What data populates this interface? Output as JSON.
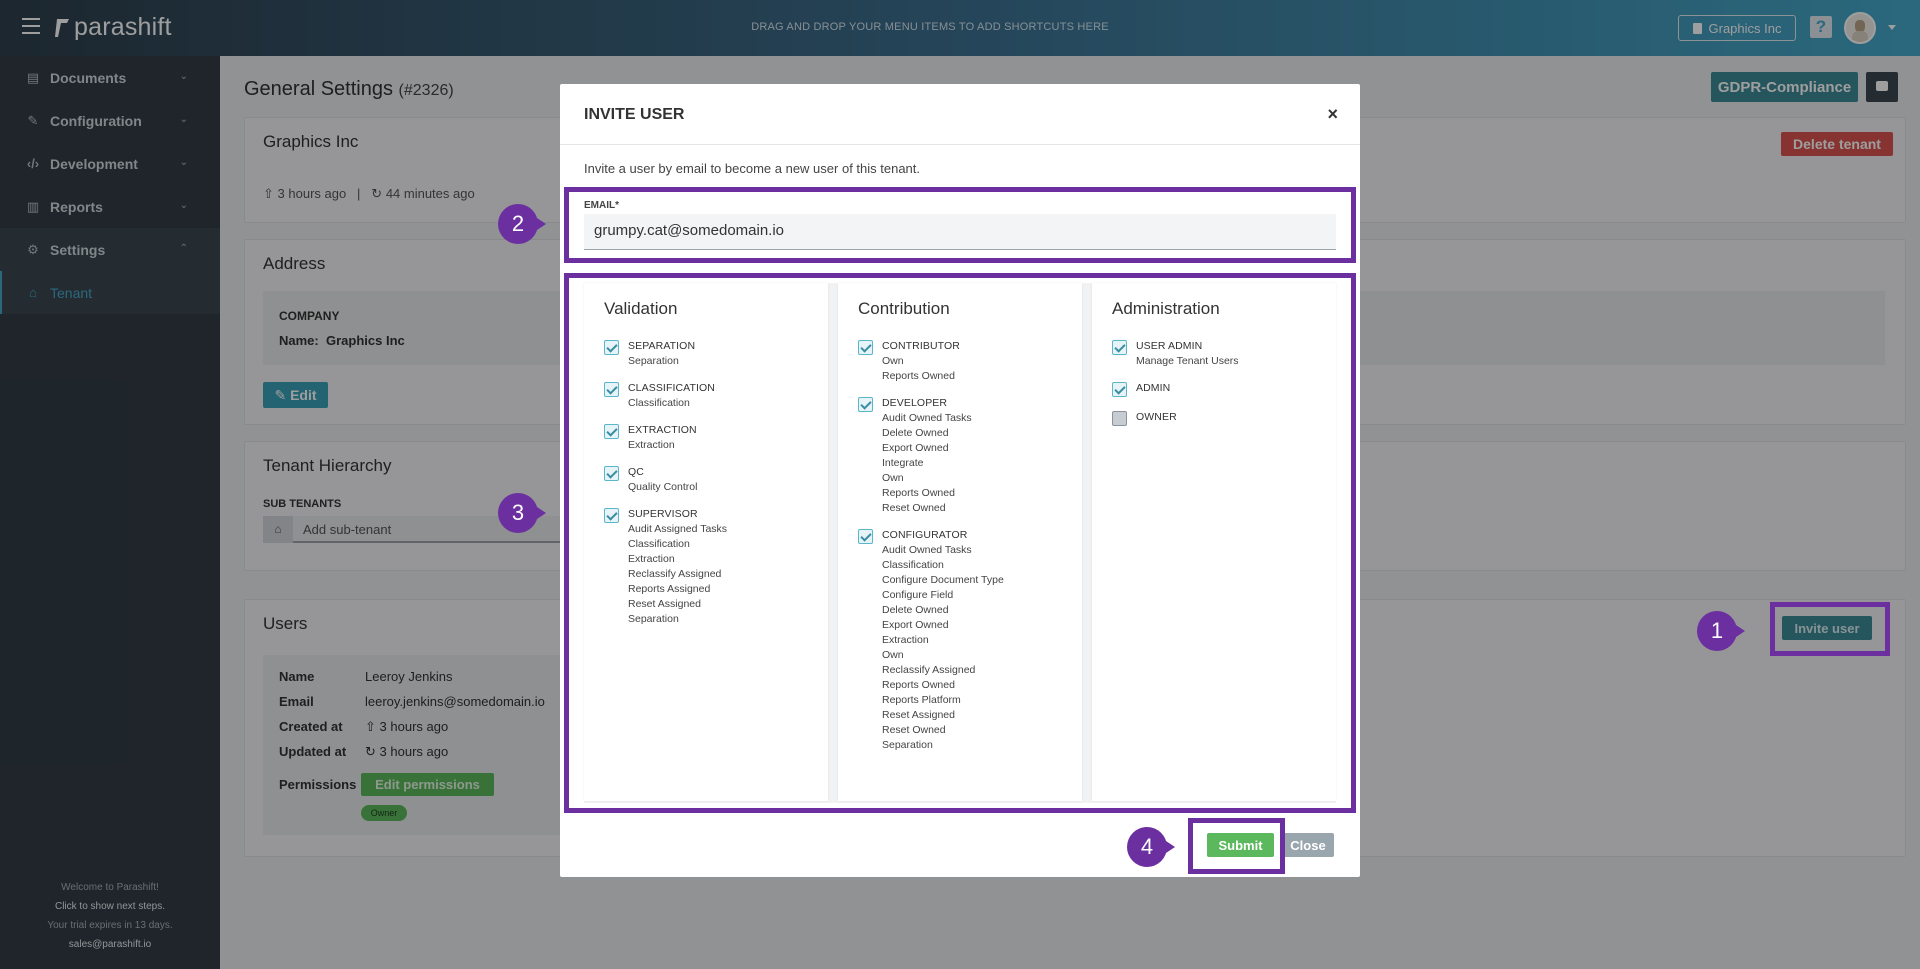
{
  "header": {
    "logo": "parashift",
    "shortcut_hint": "DRAG AND DROP YOUR MENU ITEMS TO ADD SHORTCUTS HERE",
    "tenant": "Graphics Inc",
    "help": "?"
  },
  "sidebar": {
    "items": [
      {
        "label": "Documents"
      },
      {
        "label": "Configuration"
      },
      {
        "label": "Development"
      },
      {
        "label": "Reports"
      },
      {
        "label": "Settings"
      },
      {
        "label": "Tenant"
      }
    ],
    "footer": {
      "line1": "Welcome to Parashift!",
      "line2": "Click to show next steps.",
      "line3": "Your trial expires in 13 days.",
      "line4": "sales@parashift.io"
    }
  },
  "main": {
    "title": "General Settings",
    "title_id": "(#2326)",
    "gdpr_button": "GDPR-Compliance",
    "general": {
      "name": "Graphics Inc",
      "created": "3 hours ago",
      "separator": "|",
      "updated": "44 minutes ago",
      "delete_button": "Delete tenant"
    },
    "address": {
      "title": "Address",
      "company_label": "COMPANY",
      "name_label": "Name:",
      "name_value": "Graphics Inc",
      "edit_button": "Edit"
    },
    "hierarchy": {
      "title": "Tenant Hierarchy",
      "sub_label": "SUB TENANTS",
      "placeholder": "Add sub-tenant"
    },
    "users": {
      "title": "Users",
      "invite_button": "Invite user",
      "user": {
        "name_label": "Name",
        "name": "Leeroy Jenkins",
        "email_label": "Email",
        "email": "leeroy.jenkins@somedomain.io",
        "created_label": "Created at",
        "created": "3 hours ago",
        "updated_label": "Updated at",
        "updated": "3 hours ago",
        "permissions_label": "Permissions",
        "edit_permissions": "Edit permissions",
        "badge": "Owner"
      }
    }
  },
  "modal": {
    "title": "INVITE USER",
    "close_icon": "×",
    "intro": "Invite a user by email to become a new user of this tenant.",
    "email_label": "EMAIL*",
    "email_value": "grumpy.cat@somedomain.io",
    "columns": [
      {
        "title": "Validation",
        "roles": [
          {
            "name": "SEPARATION",
            "checked": true,
            "perms": [
              "Separation"
            ]
          },
          {
            "name": "CLASSIFICATION",
            "checked": true,
            "perms": [
              "Classification"
            ]
          },
          {
            "name": "EXTRACTION",
            "checked": true,
            "perms": [
              "Extraction"
            ]
          },
          {
            "name": "QC",
            "checked": true,
            "perms": [
              "Quality Control"
            ]
          },
          {
            "name": "SUPERVISOR",
            "checked": true,
            "perms": [
              "Audit Assigned Tasks",
              "Classification",
              "Extraction",
              "Reclassify Assigned",
              "Reports Assigned",
              "Reset Assigned",
              "Separation"
            ]
          }
        ]
      },
      {
        "title": "Contribution",
        "roles": [
          {
            "name": "CONTRIBUTOR",
            "checked": true,
            "perms": [
              "Own",
              "Reports Owned"
            ]
          },
          {
            "name": "DEVELOPER",
            "checked": true,
            "perms": [
              "Audit Owned Tasks",
              "Delete Owned",
              "Export Owned",
              "Integrate",
              "Own",
              "Reports Owned",
              "Reset Owned"
            ]
          },
          {
            "name": "CONFIGURATOR",
            "checked": true,
            "perms": [
              "Audit Owned Tasks",
              "Classification",
              "Configure Document Type",
              "Configure Field",
              "Delete Owned",
              "Export Owned",
              "Extraction",
              "Own",
              "Reclassify Assigned",
              "Reports Owned",
              "Reports Platform",
              "Reset Assigned",
              "Reset Owned",
              "Separation"
            ]
          }
        ]
      },
      {
        "title": "Administration",
        "roles": [
          {
            "name": "USER ADMIN",
            "checked": true,
            "perms": [
              "Manage Tenant Users"
            ]
          },
          {
            "name": "ADMIN",
            "checked": true,
            "perms": []
          },
          {
            "name": "OWNER",
            "checked": false,
            "perms": []
          }
        ]
      }
    ],
    "submit": "Submit",
    "close": "Close"
  },
  "annotations": {
    "color": "#6b2fa0",
    "markers": [
      "1",
      "2",
      "3",
      "4"
    ]
  }
}
